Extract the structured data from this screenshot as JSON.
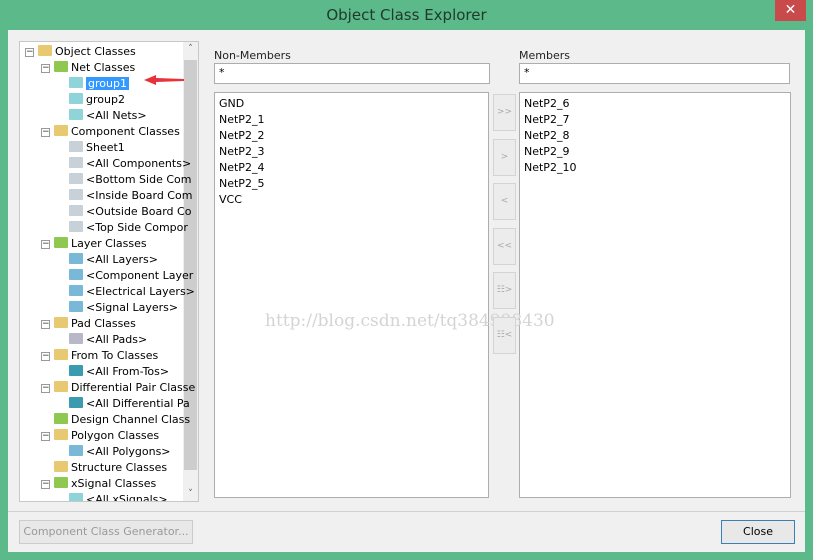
{
  "window": {
    "title": "Object Class Explorer",
    "close_glyph": "✕"
  },
  "tree": {
    "items": [
      {
        "label": "Object Classes",
        "level": 0,
        "icon": "object-classes-folder-icon",
        "color": "#e8c870",
        "exp": "−"
      },
      {
        "label": "Net Classes",
        "level": 1,
        "icon": "net-classes-folder-icon",
        "color": "#8fc850",
        "exp": "−"
      },
      {
        "label": "group1",
        "level": 2,
        "icon": "net-icon",
        "color": "#8fd4d8",
        "selected": true
      },
      {
        "label": "group2",
        "level": 2,
        "icon": "net-icon",
        "color": "#8fd4d8"
      },
      {
        "label": "<All Nets>",
        "level": 2,
        "icon": "net-icon",
        "color": "#8fd4d8"
      },
      {
        "label": "Component Classes",
        "level": 1,
        "icon": "component-classes-folder-icon",
        "color": "#e8c870",
        "exp": "−"
      },
      {
        "label": "Sheet1",
        "level": 2,
        "icon": "component-icon",
        "color": "#c8d0d8"
      },
      {
        "label": "<All Components>",
        "level": 2,
        "icon": "component-icon",
        "color": "#c8d0d8"
      },
      {
        "label": "<Bottom Side Com",
        "level": 2,
        "icon": "component-icon",
        "color": "#c8d0d8"
      },
      {
        "label": "<Inside Board Com",
        "level": 2,
        "icon": "component-icon",
        "color": "#c8d0d8"
      },
      {
        "label": "<Outside Board Co",
        "level": 2,
        "icon": "component-icon",
        "color": "#c8d0d8"
      },
      {
        "label": "<Top Side Compor",
        "level": 2,
        "icon": "component-icon",
        "color": "#c8d0d8"
      },
      {
        "label": "Layer Classes",
        "level": 1,
        "icon": "layer-classes-folder-icon",
        "color": "#8fc850",
        "exp": "−"
      },
      {
        "label": "<All Layers>",
        "level": 2,
        "icon": "layer-icon",
        "color": "#7ab8d8"
      },
      {
        "label": "<Component Layer",
        "level": 2,
        "icon": "layer-icon",
        "color": "#7ab8d8"
      },
      {
        "label": "<Electrical Layers>",
        "level": 2,
        "icon": "layer-icon",
        "color": "#7ab8d8"
      },
      {
        "label": "<Signal Layers>",
        "level": 2,
        "icon": "layer-icon",
        "color": "#7ab8d8"
      },
      {
        "label": "Pad Classes",
        "level": 1,
        "icon": "pad-classes-folder-icon",
        "color": "#e8c870",
        "exp": "−"
      },
      {
        "label": "<All Pads>",
        "level": 2,
        "icon": "pad-icon",
        "color": "#b8b8c8"
      },
      {
        "label": "From To Classes",
        "level": 1,
        "icon": "from-to-classes-folder-icon",
        "color": "#e8c870",
        "exp": "−"
      },
      {
        "label": "<All From-Tos>",
        "level": 2,
        "icon": "from-to-icon",
        "color": "#3a9ab0"
      },
      {
        "label": "Differential Pair Classe",
        "level": 1,
        "icon": "diff-pair-classes-folder-icon",
        "color": "#e8c870",
        "exp": "−"
      },
      {
        "label": "<All Differential Pa",
        "level": 2,
        "icon": "diff-pair-icon",
        "color": "#3a9ab0"
      },
      {
        "label": "Design Channel Class",
        "level": 1,
        "icon": "design-channel-folder-icon",
        "color": "#8fc850"
      },
      {
        "label": "Polygon Classes",
        "level": 1,
        "icon": "polygon-classes-folder-icon",
        "color": "#e8c870",
        "exp": "−"
      },
      {
        "label": "<All Polygons>",
        "level": 2,
        "icon": "polygon-icon",
        "color": "#7ab8d8"
      },
      {
        "label": "Structure Classes",
        "level": 1,
        "icon": "structure-classes-folder-icon",
        "color": "#e8c870"
      },
      {
        "label": "xSignal Classes",
        "level": 1,
        "icon": "xsignal-classes-folder-icon",
        "color": "#8fc850",
        "exp": "−"
      },
      {
        "label": "<All xSignals>",
        "level": 2,
        "icon": "xsignal-icon",
        "color": "#8fd4d8"
      }
    ],
    "scroll_up": "˄",
    "scroll_down": "˅"
  },
  "non_members": {
    "label": "Non-Members",
    "filter": "*",
    "items": [
      "GND",
      "NetP2_1",
      "NetP2_2",
      "NetP2_3",
      "NetP2_4",
      "NetP2_5",
      "VCC"
    ]
  },
  "members": {
    "label": "Members",
    "filter": "*",
    "items": [
      "NetP2_6",
      "NetP2_7",
      "NetP2_8",
      "NetP2_9",
      "NetP2_10"
    ]
  },
  "move_buttons": [
    ">>",
    ">",
    "<",
    "<<",
    "☷>",
    "☷<"
  ],
  "watermark": "http://blog.csdn.net/tq384998430",
  "footer": {
    "generator_label": "Component Class Generator...",
    "close_label": "Close"
  },
  "colors": {
    "titlebar": "#5cb98a",
    "selection": "#3399ff",
    "close": "#c94a4a"
  }
}
